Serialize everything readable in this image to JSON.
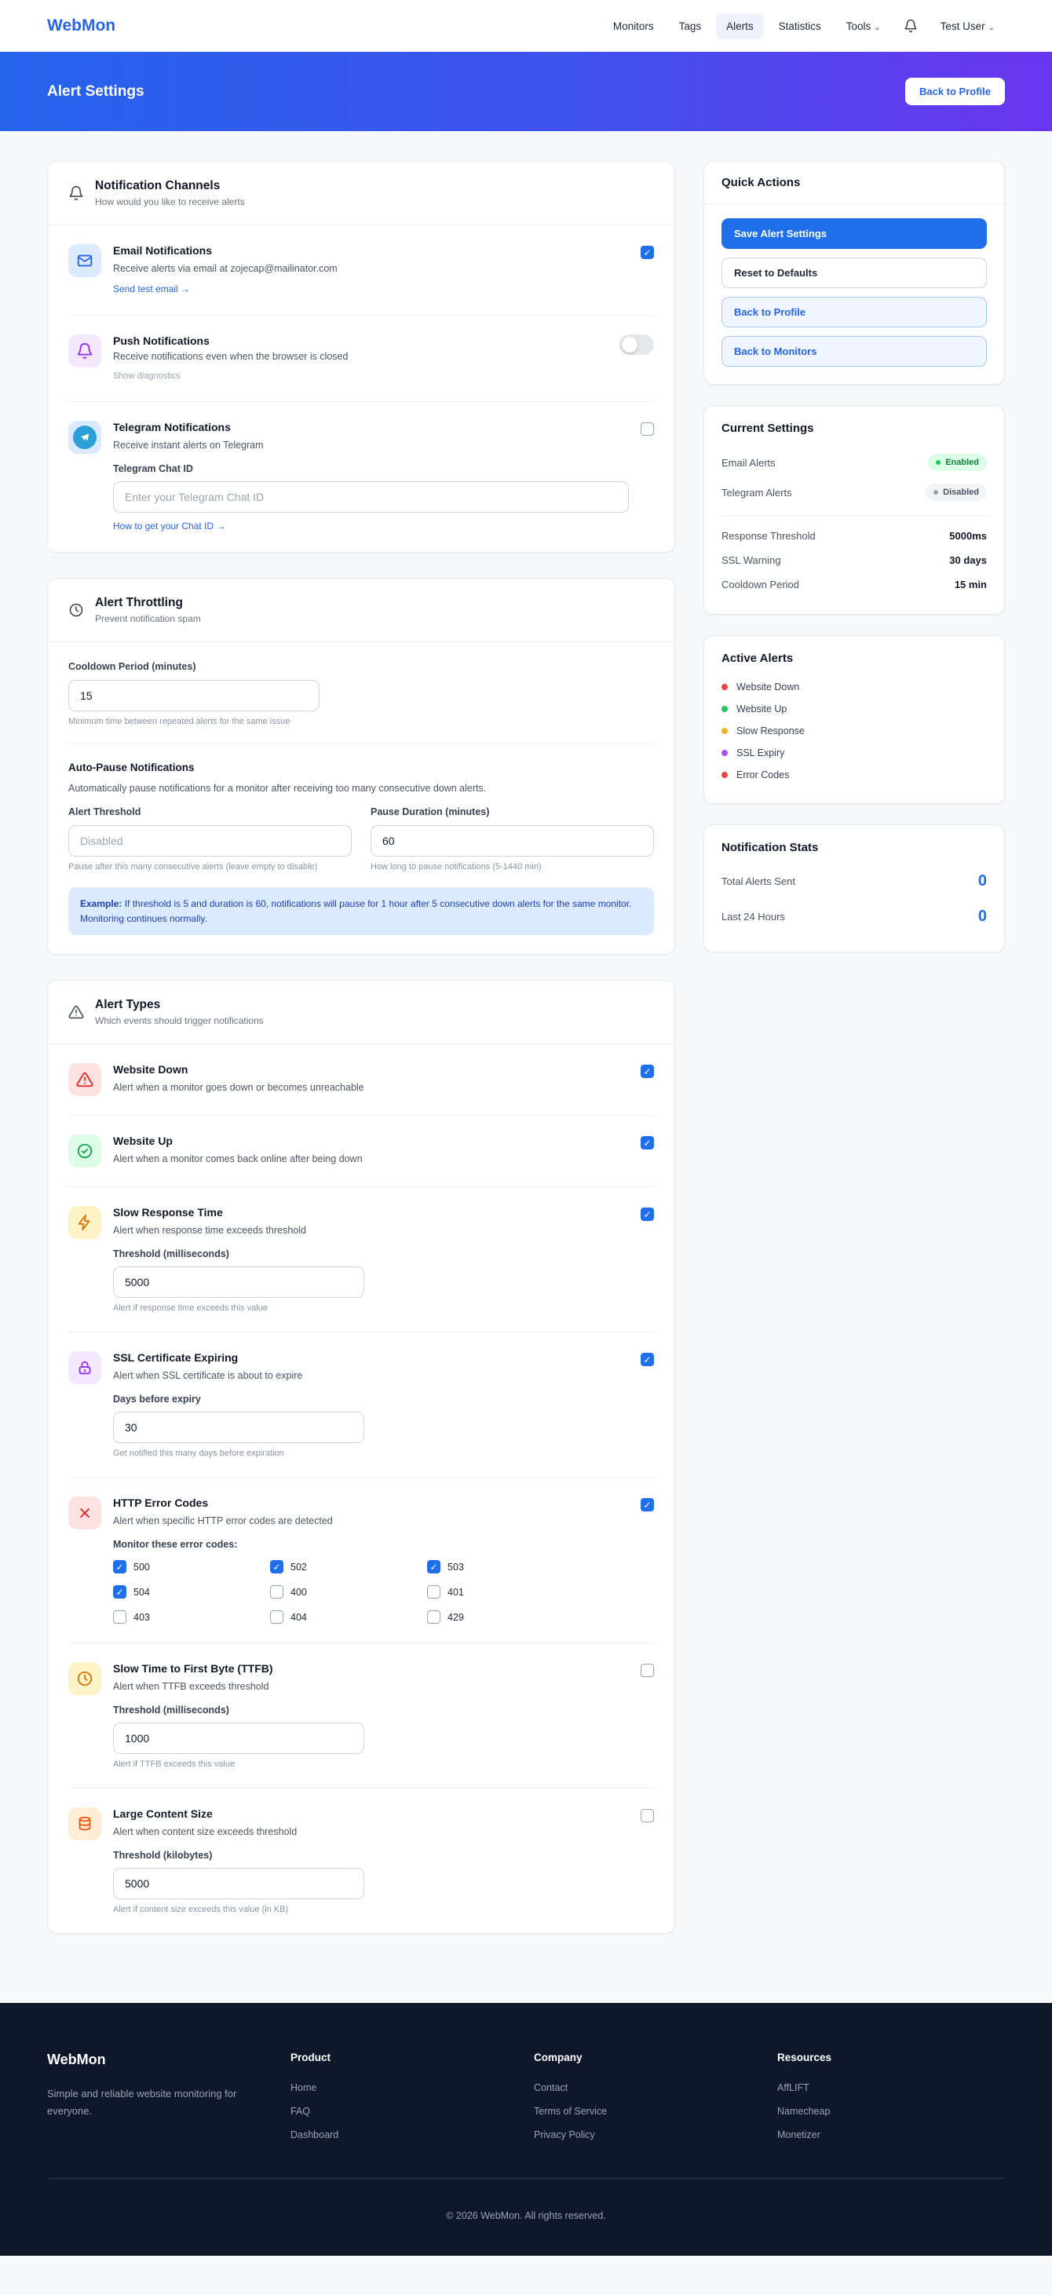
{
  "brand": "WebMon",
  "colors": {
    "accent": "#2563eb",
    "banner_gradient_start": "#2563eb",
    "banner_gradient_end": "#6a35ee",
    "enabled_green": "#22c55e",
    "disabled_gray": "#9ca3af",
    "footer_bg": "#0f172a"
  },
  "nav": {
    "items": [
      {
        "label": "Monitors"
      },
      {
        "label": "Tags"
      },
      {
        "label": "Alerts"
      },
      {
        "label": "Statistics"
      },
      {
        "label": "Tools"
      }
    ],
    "user": "Test User"
  },
  "banner": {
    "title": "Alert Settings",
    "back_button": "Back to Profile"
  },
  "channels": {
    "title": "Notification Channels",
    "subtitle": "How would you like to receive alerts",
    "email": {
      "title": "Email Notifications",
      "desc": "Receive alerts via email at zojecap@mailinator.com",
      "link": "Send test email →",
      "checked": true
    },
    "push": {
      "title": "Push Notifications",
      "desc": "Receive notifications even when the browser is closed",
      "link": "Show diagnostics",
      "toggle_on": false
    },
    "telegram": {
      "title": "Telegram Notifications",
      "desc": "Receive instant alerts on Telegram",
      "input_label": "Telegram Chat ID",
      "placeholder": "Enter your Telegram Chat ID",
      "link": "How to get your Chat ID →",
      "checked": false
    }
  },
  "throttling": {
    "title": "Alert Throttling",
    "subtitle": "Prevent notification spam",
    "cooldown_label": "Cooldown Period (minutes)",
    "cooldown_value": "15",
    "cooldown_helper": "Minimum time between repeated alerts for the same issue",
    "autopause_title": "Auto-Pause Notifications",
    "autopause_desc": "Automatically pause notifications for a monitor after receiving too many consecutive down alerts.",
    "threshold_label": "Alert Threshold",
    "threshold_placeholder": "Disabled",
    "threshold_helper": "Pause after this many consecutive alerts (leave empty to disable)",
    "duration_label": "Pause Duration (minutes)",
    "duration_value": "60",
    "duration_helper": "How long to pause notifications (5-1440 min)",
    "example_bold": "Example:",
    "example_text": " If threshold is 5 and duration is 60, notifications will pause for 1 hour after 5 consecutive down alerts for the same monitor. Monitoring continues normally."
  },
  "alert_types": {
    "title": "Alert Types",
    "subtitle": "Which events should trigger notifications",
    "website_down": {
      "title": "Website Down",
      "desc": "Alert when a monitor goes down or becomes unreachable",
      "checked": true
    },
    "website_up": {
      "title": "Website Up",
      "desc": "Alert when a monitor comes back online after being down",
      "checked": true
    },
    "slow_response": {
      "title": "Slow Response Time",
      "desc": "Alert when response time exceeds threshold",
      "checked": true,
      "input_label": "Threshold (milliseconds)",
      "input_value": "5000",
      "helper": "Alert if response time exceeds this value"
    },
    "ssl": {
      "title": "SSL Certificate Expiring",
      "desc": "Alert when SSL certificate is about to expire",
      "checked": true,
      "input_label": "Days before expiry",
      "input_value": "30",
      "helper": "Get notified this many days before expiration"
    },
    "http_errors": {
      "title": "HTTP Error Codes",
      "desc": "Alert when specific HTTP error codes are detected",
      "checked": true,
      "codes_label": "Monitor these error codes:",
      "codes": [
        {
          "code": "500",
          "checked": true
        },
        {
          "code": "502",
          "checked": true
        },
        {
          "code": "503",
          "checked": true
        },
        {
          "code": "504",
          "checked": true
        },
        {
          "code": "400",
          "checked": false
        },
        {
          "code": "401",
          "checked": false
        },
        {
          "code": "403",
          "checked": false
        },
        {
          "code": "404",
          "checked": false
        },
        {
          "code": "429",
          "checked": false
        }
      ]
    },
    "ttfb": {
      "title": "Slow Time to First Byte (TTFB)",
      "desc": "Alert when TTFB exceeds threshold",
      "checked": false,
      "input_label": "Threshold (milliseconds)",
      "input_value": "1000",
      "helper": "Alert if TTFB exceeds this value"
    },
    "content_size": {
      "title": "Large Content Size",
      "desc": "Alert when content size exceeds threshold",
      "checked": false,
      "input_label": "Threshold (kilobytes)",
      "input_value": "5000",
      "helper": "Alert if content size exceeds this value (in KB)"
    }
  },
  "quick_actions": {
    "title": "Quick Actions",
    "save": "Save Alert Settings",
    "reset": "Reset to Defaults",
    "back_profile": "Back to Profile",
    "back_monitors": "Back to Monitors"
  },
  "current_settings": {
    "title": "Current Settings",
    "email_label": "Email Alerts",
    "email_status": "Enabled",
    "telegram_label": "Telegram Alerts",
    "telegram_status": "Disabled",
    "rows": [
      {
        "label": "Response Threshold",
        "value": "5000ms"
      },
      {
        "label": "SSL Warning",
        "value": "30 days"
      },
      {
        "label": "Cooldown Period",
        "value": "15 min"
      }
    ]
  },
  "active_alerts": {
    "title": "Active Alerts",
    "items": [
      {
        "label": "Website Down",
        "color": "#ef4444"
      },
      {
        "label": "Website Up",
        "color": "#22c55e"
      },
      {
        "label": "Slow Response",
        "color": "#f0b429"
      },
      {
        "label": "SSL Expiry",
        "color": "#a855f7"
      },
      {
        "label": "Error Codes",
        "color": "#ef4444"
      }
    ]
  },
  "stats": {
    "title": "Notification Stats",
    "rows": [
      {
        "label": "Total Alerts Sent",
        "value": "0"
      },
      {
        "label": "Last 24 Hours",
        "value": "0"
      }
    ]
  },
  "footer": {
    "brand": "WebMon",
    "tagline": "Simple and reliable website monitoring for everyone.",
    "columns": [
      {
        "heading": "Product",
        "links": [
          "Home",
          "FAQ",
          "Dashboard"
        ]
      },
      {
        "heading": "Company",
        "links": [
          "Contact",
          "Terms of Service",
          "Privacy Policy"
        ]
      },
      {
        "heading": "Resources",
        "links": [
          "AffLIFT",
          "Namecheap",
          "Monetizer"
        ]
      }
    ],
    "copyright": "© 2026 WebMon. All rights reserved."
  }
}
